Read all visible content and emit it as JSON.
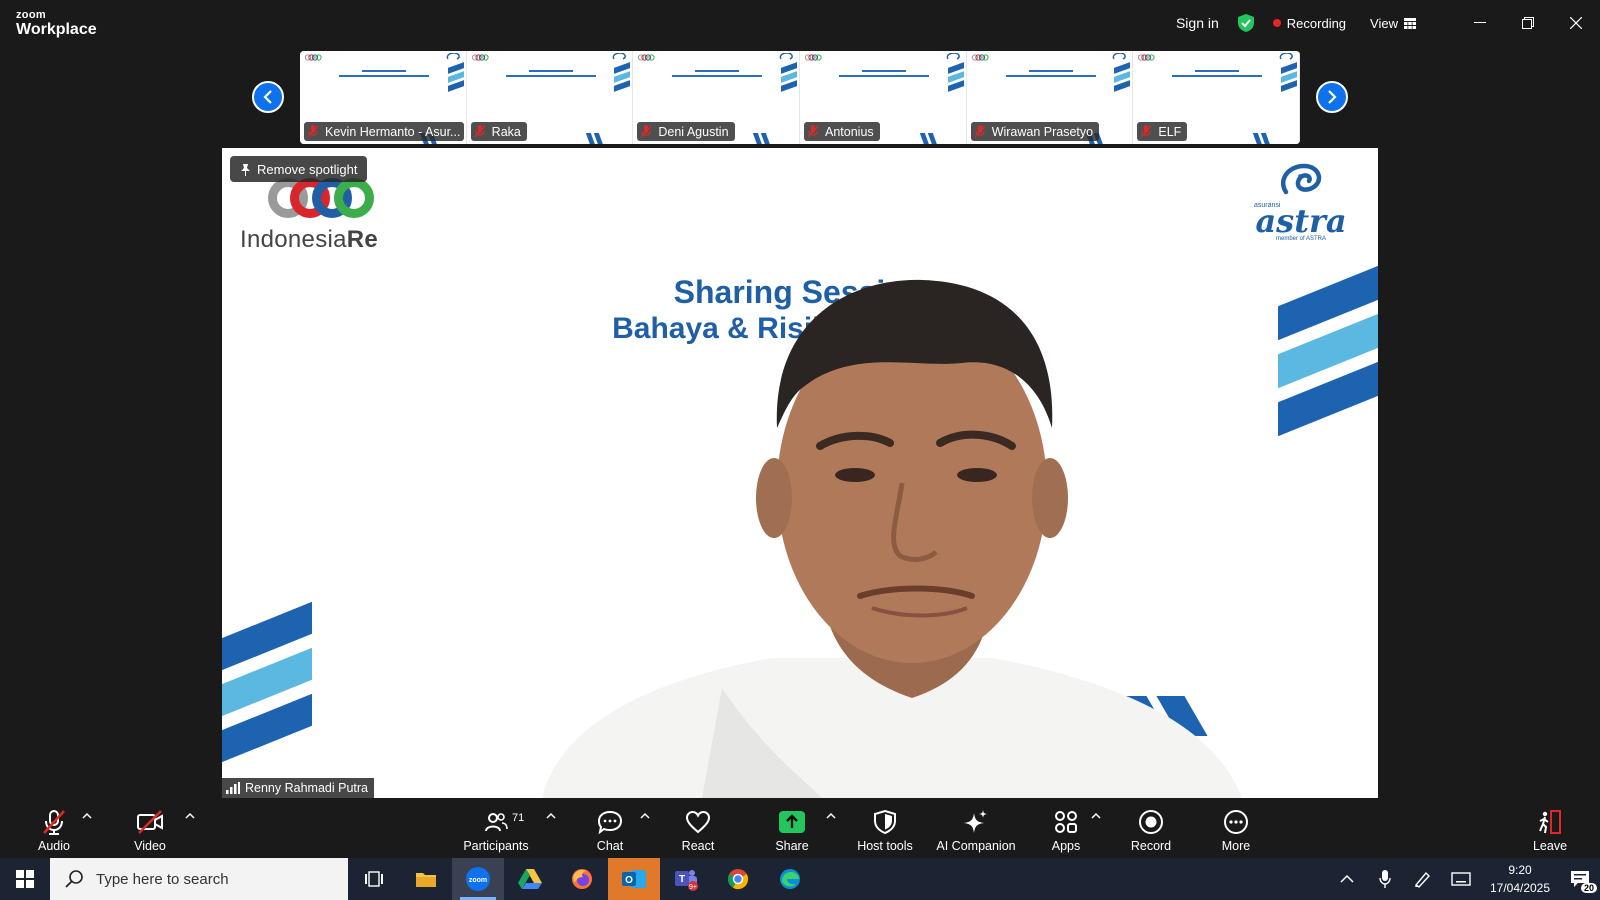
{
  "titlebar": {
    "brand_top": "zoom",
    "brand_bottom": "Workplace",
    "sign_in": "Sign in",
    "recording": "Recording",
    "view": "View"
  },
  "thumbnails": [
    {
      "name": "Kevin Hermanto - Asur..."
    },
    {
      "name": "Raka"
    },
    {
      "name": "Deni Agustin"
    },
    {
      "name": "Antonius"
    },
    {
      "name": "Wirawan Prasetyo"
    },
    {
      "name": "ELF"
    }
  ],
  "stage": {
    "remove_spotlight": "Remove spotlight",
    "logo_left_a": "Indonesia",
    "logo_left_b": "Re",
    "logo_right_small": "asuransi",
    "logo_right_word": "astra",
    "logo_right_tag": "member of ASTRA",
    "title_line1": "Sharing Session",
    "title_line2": "Bahaya & Risiko E                (EV)",
    "speaker": "Renny Rahmadi Putra"
  },
  "toolbar": {
    "audio": "Audio",
    "video": "Video",
    "participants": "Participants",
    "participants_count": "71",
    "chat": "Chat",
    "react": "React",
    "share": "Share",
    "host_tools": "Host tools",
    "ai_companion": "AI Companion",
    "apps": "Apps",
    "record": "Record",
    "more": "More",
    "leave": "Leave"
  },
  "taskbar": {
    "search_placeholder": "Type here to search",
    "time": "9:20",
    "date": "17/04/2025",
    "notifications": "20"
  },
  "colors": {
    "accent_blue": "#0e72ed",
    "slide_blue": "#1f5fa6",
    "share_green": "#22c55e",
    "recording_red": "#e02828"
  }
}
